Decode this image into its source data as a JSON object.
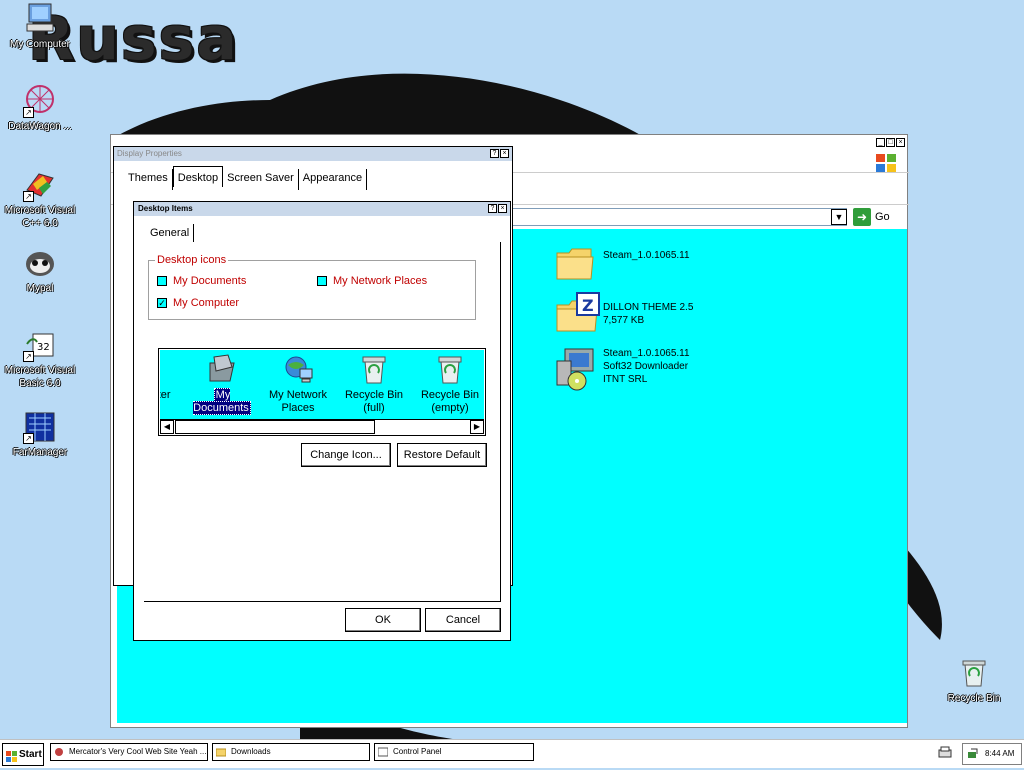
{
  "desktop": {
    "logo_text": "Russa",
    "icons": [
      {
        "label": "My Computer",
        "icon": "my-computer-icon"
      },
      {
        "label": "DataWagon ...",
        "icon": "datawagon-icon"
      },
      {
        "label": "Microsoft Visual C++ 6.0",
        "icon": "visual-cpp-icon"
      },
      {
        "label": "Mypal",
        "icon": "mypal-icon"
      },
      {
        "label": "Microsoft Visual Basic 6.0",
        "icon": "visual-basic-icon"
      },
      {
        "label": "FarManager",
        "icon": "farmanager-icon"
      },
      {
        "label": "Recycle Bin",
        "icon": "recycle-bin-icon"
      }
    ]
  },
  "explorer": {
    "title": "Downloads",
    "go_label": "Go",
    "files": [
      {
        "name": "Steam_1.0.1065.11",
        "line2": "",
        "line3": "",
        "icon": "folder-icon"
      },
      {
        "name": "DILLON THEME 2.5",
        "line2": "7,577 KB",
        "line3": "",
        "icon": "zip-folder-icon"
      },
      {
        "name": "Steam_1.0.1065.11",
        "line2": "Soft32 Downloader",
        "line3": "ITNT SRL",
        "icon": "installer-icon"
      }
    ]
  },
  "desktop_properties": {
    "title": "Display Properties",
    "tabs": [
      "Themes",
      "Desktop",
      "Screen Saver",
      "Appearance"
    ],
    "active_tab": "Desktop"
  },
  "desktop_items": {
    "title": "Desktop Items",
    "tab": "General",
    "group_title": "Desktop icons",
    "checkboxes": [
      {
        "label": "My Documents",
        "checked": false
      },
      {
        "label": "My Network Places",
        "checked": false
      },
      {
        "label": "My Computer",
        "checked": true
      }
    ],
    "list_items": [
      {
        "label": "puter",
        "icon": "my-computer-icon"
      },
      {
        "label": "My Documents",
        "icon": "my-documents-icon",
        "selected": true
      },
      {
        "label": "My Network Places",
        "icon": "network-places-icon"
      },
      {
        "label": "Recycle Bin (full)",
        "icon": "recycle-bin-full-icon"
      },
      {
        "label": "Recycle Bin (empty)",
        "icon": "recycle-bin-empty-icon"
      }
    ],
    "list_labels": {
      "item0": "puter",
      "item1": "My Documents",
      "item2_l1": "My Network",
      "item2_l2": "Places",
      "item3_l1": "Recycle Bin",
      "item3_l2": "(full)",
      "item4_l1": "Recycle Bin",
      "item4_l2": "(empty)"
    },
    "change_icon_label": "Change Icon...",
    "restore_default_label": "Restore Default",
    "ok_label": "OK",
    "cancel_label": "Cancel"
  },
  "taskbar": {
    "start_label": "Start",
    "tasks": [
      {
        "label": "Mercator's Very Cool Web Site Yeah ...",
        "icon": "browser-icon"
      },
      {
        "label": "Downloads",
        "icon": "folder-icon"
      },
      {
        "label": "Control Panel",
        "icon": "control-panel-icon"
      }
    ],
    "clock": "8:44 AM"
  },
  "colors": {
    "desktop_bg": "#b9daf5",
    "file_pane": "#00ffff",
    "label_red": "#c00000",
    "selection": "#000080"
  }
}
